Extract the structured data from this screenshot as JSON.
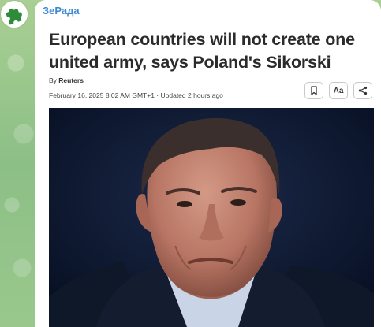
{
  "channel": {
    "name": "ЗеРада",
    "avatar_icon": "puzzle-piece-icon",
    "accent_color": "#3a8ad1"
  },
  "article": {
    "headline": "European countries will not create one united army, says Poland's Sikorski",
    "byline_prefix": "By",
    "author": "Reuters",
    "dateline": "February 16, 2025 8:02 AM GMT+1 · Updated 2 hours ago",
    "photo_alt": "Portrait of Radoslaw Sikorski"
  },
  "actions": {
    "bookmark_icon": "bookmark-icon",
    "text_size_label": "Aa",
    "share_icon": "share-icon"
  }
}
